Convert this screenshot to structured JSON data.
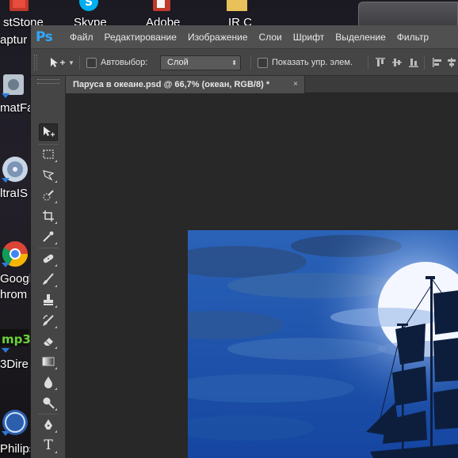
{
  "desktop": {
    "top_icons": [
      {
        "label": "stStone",
        "icon": "faststone-capture-icon"
      },
      {
        "label": "Skype",
        "icon": "skype-icon"
      },
      {
        "label": "Adobe",
        "icon": "adobe-icon"
      },
      {
        "label": "IR C",
        "icon": "folder-icon"
      }
    ],
    "left_icons": [
      {
        "label": "aptur",
        "icon": "faststone-capture-icon"
      },
      {
        "label": "matFa",
        "icon": "format-factory-icon"
      },
      {
        "label": "ltraIS",
        "icon": "ultraiso-icon"
      },
      {
        "label": "Google",
        "label2": "hrom",
        "icon": "google-chrome-icon"
      },
      {
        "label": "3Dire",
        "icon": "mp3-directcut-icon"
      },
      {
        "label": "Philips",
        "icon": "philips-icon"
      }
    ]
  },
  "photoshop": {
    "logo": "Ps",
    "menu": [
      "Файл",
      "Редактирование",
      "Изображение",
      "Слои",
      "Шрифт",
      "Выделение",
      "Фильтр"
    ],
    "options": {
      "autoselect_label": "Автовыбор:",
      "autoselect_value": "Слой",
      "show_controls_label": "Показать упр. элем."
    },
    "document_tab": {
      "title": "Паруса в океане.psd @ 66,7% (океан, RGB/8) *",
      "close": "×"
    },
    "tools": [
      "move-tool",
      "rect-marquee-tool",
      "lasso-tool",
      "quick-selection-tool",
      "crop-tool",
      "eyedropper-tool",
      "spot-healing-tool",
      "brush-tool",
      "clone-stamp-tool",
      "history-brush-tool",
      "eraser-tool",
      "gradient-tool",
      "blur-tool",
      "dodge-tool",
      "pen-tool",
      "type-tool",
      "path-selection-tool",
      "shape-tool"
    ],
    "type_tool_glyph": "T"
  },
  "colors": {
    "ps_accent": "#30a8ff",
    "menubar_bg": "#505050",
    "workspace_bg": "#282828",
    "ocean_blue": "#2760b3"
  }
}
